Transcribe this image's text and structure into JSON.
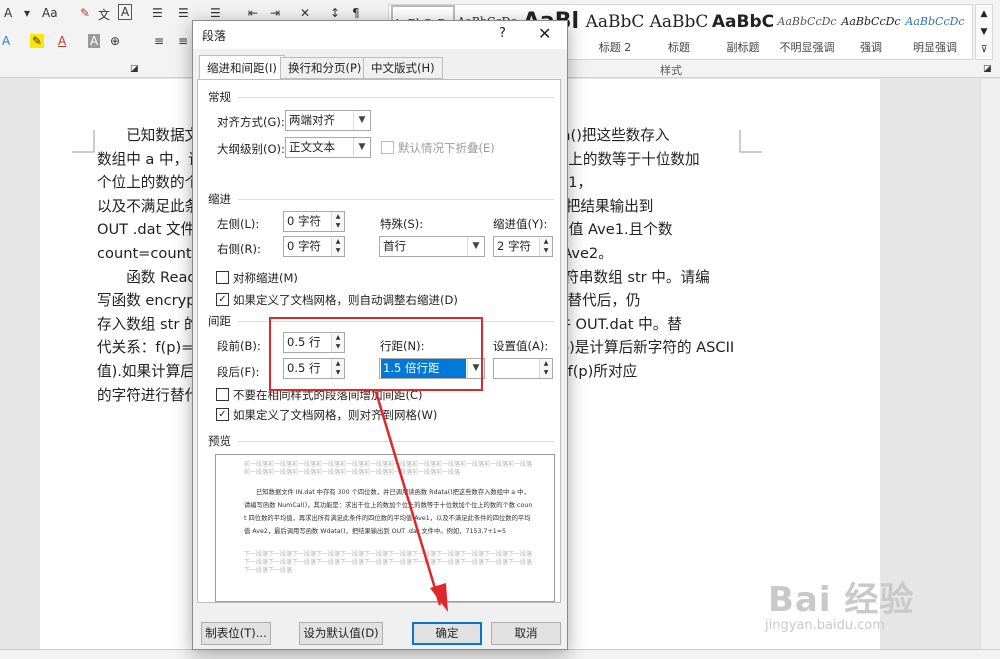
{
  "ribbon": {
    "row1": [
      "A",
      "A",
      "Aa",
      "A",
      "A"
    ],
    "row2": [
      "A",
      "A",
      "A"
    ],
    "styles_group_label": "样式",
    "styles": [
      {
        "preview": "AaBbCcDc",
        "name": ""
      },
      {
        "preview": "AaBbCcDc",
        "name": ""
      },
      {
        "preview": "AaBl",
        "name": ""
      },
      {
        "preview": "AaBbC",
        "name": "标题 2"
      },
      {
        "preview": "AaBbC",
        "name": "标题"
      },
      {
        "preview": "AaBbC",
        "name": "副标题"
      },
      {
        "preview": "AaBbCcDc",
        "name": "不明显强调"
      },
      {
        "preview": "AaBbCcDc",
        "name": "强调"
      },
      {
        "preview": "AaBbCcDc",
        "name": "明显强调"
      }
    ]
  },
  "document": {
    "lines": [
      "　　已知数据文件 IN.dat 中存有 300 个四位数，并已调用读函数 Rdata()把这些数存入",
      "数组中 a 中，请编写函数 NumCal()，其功能是：求出千位上的数加个位上的数等于十位数加",
      "个位上的数的个数 count，再求出所有满足此条件的四位数的平均值 Ave1，",
      "以及不满足此条件的四位数的平均值 Ave2，最后调用写函数 Wdata()，把结果输出到",
      "OUT .dat 文件中。例如：7153，7+3=1+5，则该数满足条件计算平均值 Ave1.且个数",
      "count=count+1。8129，8+9≠1+2，则该数不满足条件计算平均值 Ave2。",
      "　　函数 ReadDat()实现从文件 IN.dat 中读取一篇英文文章，存入到字符串数组 str 中。请编",
      "写函数 encryptChar()，按给定的替代关系对数组 str 中的所有字符进行替代后，仍",
      "存入数组 str 的对应的位置上，最后调用函数 WriteDat()把结果输出文件 OUT.dat 中。替",
      "代关系：f(p)=p*11 mod 256（p 是数组中某一个字符的 ASCII 值，f(p)是计算后新字符的 ASCII",
      "值).如果计算后 f(p)值小于等于 32 或大于 130，则该字符不变，否则将 f(p)所对应",
      "的字符进行替代。"
    ]
  },
  "dialog": {
    "title": "段落",
    "help": "?",
    "close": "✕",
    "tabs": [
      "缩进和间距(I)",
      "换行和分页(P)",
      "中文版式(H)"
    ],
    "general": {
      "heading": "常规",
      "alignment_label": "对齐方式(G):",
      "alignment_value": "两端对齐",
      "outline_label": "大纲级别(O):",
      "outline_value": "正文文本",
      "collapse_label": "默认情况下折叠(E)"
    },
    "indent": {
      "heading": "缩进",
      "left_label": "左侧(L):",
      "left_value": "0 字符",
      "right_label": "右侧(R):",
      "right_value": "0 字符",
      "special_label": "特殊(S):",
      "special_value": "首行",
      "by_label": "缩进值(Y):",
      "by_value": "2 字符",
      "mirror_label": "对称缩进(M)",
      "grid_label": "如果定义了文档网格，则自动调整右缩进(D)"
    },
    "spacing": {
      "heading": "间距",
      "before_label": "段前(B):",
      "before_value": "0.5 行",
      "after_label": "段后(F):",
      "after_value": "0.5 行",
      "line_label": "行距(N):",
      "line_value": "1.5 倍行距",
      "at_label": "设置值(A):",
      "at_value": "",
      "no_space_label": "不要在相同样式的段落间增加间距(C)",
      "snap_label": "如果定义了文档网格，则对齐到网格(W)"
    },
    "preview": {
      "heading": "预览",
      "prev_text": "前一段落前一段落前一段落前一段落前一段落前一段落前一段落前一段落前一段落前一段落前一段落前一段落前一段落前一段落前一段落前一段落前一段落前一段落前一段落前一段落前一段落",
      "sample_text": "已知数据文件 IN.dat 中存有 300 个四位数，并已调用读函数 Rdata()把这些数存入数组中 a 中，请编写函数 NumCal()，其功能是：求出千位上的数加个位上的数等于十位数加个位上的数的个数 count 四位数的平均值，再求出所有满足此条件的四位数的平均值 Ave1，以及不满足此条件的四位数的平均值 Ave2，最后调用写函数 Wdata()，把结果输出到 OUT .dat 文件中。例如，7153,7+1=5",
      "next_text": "下一段落下一段落下一段落下一段落下一段落下一段落下一段落下一段落下一段落下一段落下一段落下一段落下一段落下一段落下一段落下一段落下一段落下一段落下一段落下一段落下一段落下一段落下一段落下一段落下一段落下一段落"
    },
    "buttons": {
      "tabs": "制表位(T)...",
      "default": "设为默认值(D)",
      "ok": "确定",
      "cancel": "取消"
    }
  },
  "watermark": {
    "brand": "Bai 经验",
    "url": "jingyan.baidu.com"
  }
}
